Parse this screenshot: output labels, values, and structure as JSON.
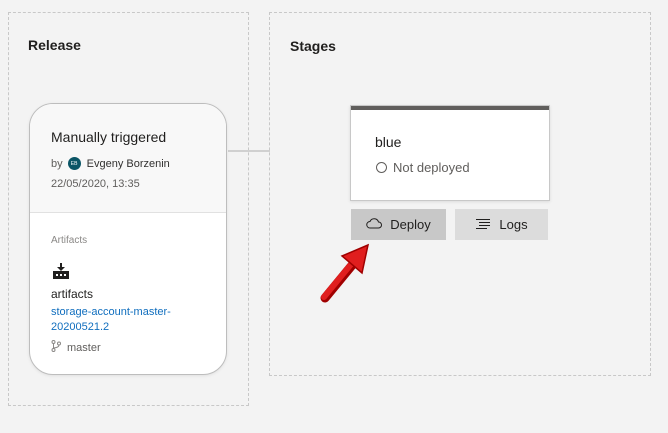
{
  "release": {
    "title": "Release",
    "card": {
      "trigger": "Manually triggered",
      "by_label": "by",
      "avatar_initials": "EB",
      "author": "Evgeny Borzenin",
      "date": "22/05/2020, 13:35",
      "artifacts_label": "Artifacts",
      "artifact_icon": "factory-icon",
      "artifact_name": "artifacts",
      "artifact_version": "storage-account-master-20200521.2",
      "branch_icon": "branch-icon",
      "branch": "master"
    }
  },
  "stages": {
    "title": "Stages",
    "items": [
      {
        "name": "blue",
        "status": "Not deployed",
        "status_icon": "circle-icon"
      }
    ],
    "deploy_button": {
      "label": "Deploy",
      "icon": "cloud-icon"
    },
    "logs_button": {
      "label": "Logs",
      "icon": "logs-icon"
    }
  },
  "colors": {
    "link": "#106ebe",
    "avatar": "#0b5566",
    "annotation_arrow": "#e01e1e"
  }
}
